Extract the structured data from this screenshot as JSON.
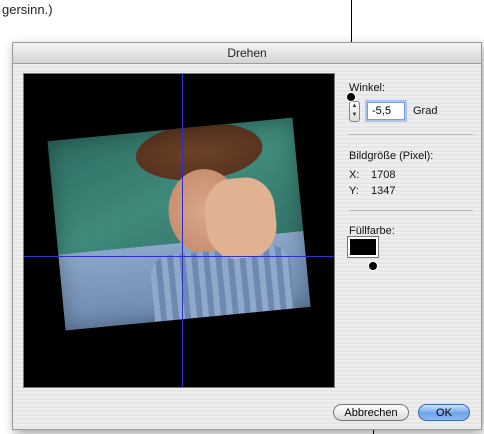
{
  "caption": "gersinn.)",
  "dialog": {
    "title": "Drehen",
    "angle": {
      "label": "Winkel:",
      "value": "-5,5",
      "unit": "Grad"
    },
    "image_size": {
      "label": "Bildgröße (Pixel):",
      "x_label": "X:",
      "x_value": "1708",
      "y_label": "Y:",
      "y_value": "1347"
    },
    "fill": {
      "label": "Füllfarbe:",
      "color": "#000000"
    },
    "buttons": {
      "cancel": "Abbrechen",
      "ok": "OK"
    }
  }
}
